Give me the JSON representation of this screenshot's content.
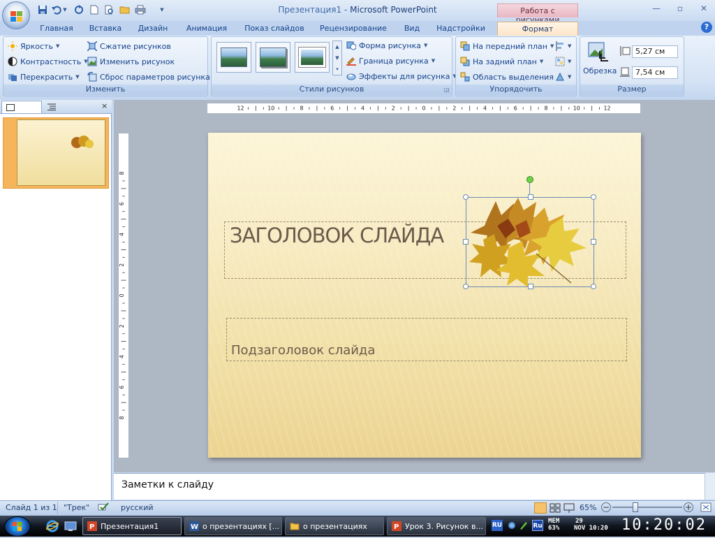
{
  "window": {
    "doc_title": "Презентация1",
    "separator": " - ",
    "app_title": "Microsoft PowerPoint",
    "context_header": "Работа с рисунками"
  },
  "tabs": [
    "Главная",
    "Вставка",
    "Дизайн",
    "Анимация",
    "Показ слайдов",
    "Рецензирование",
    "Вид",
    "Надстройки",
    "Формат"
  ],
  "ribbon": {
    "adjust": {
      "label": "Изменить",
      "brightness": "Яркость",
      "contrast": "Контрастность",
      "recolor": "Перекрасить",
      "compress": "Сжатие рисунков",
      "change": "Изменить рисунок",
      "reset": "Сброс параметров рисунка"
    },
    "styles": {
      "label": "Стили рисунков",
      "shape": "Форма рисунка",
      "border": "Граница рисунка",
      "effects": "Эффекты для рисунка"
    },
    "arrange": {
      "label": "Упорядочить",
      "front": "На передний план",
      "back": "На задний план",
      "selection": "Область выделения"
    },
    "size": {
      "label": "Размер",
      "crop": "Обрезка",
      "height": "5,27 см",
      "width": "7,54 см"
    }
  },
  "panel": {
    "slide_number": "1"
  },
  "ruler": {
    "h_labels": [
      "12",
      "10",
      "8",
      "6",
      "4",
      "2",
      "0",
      "2",
      "4",
      "6",
      "8",
      "10",
      "12"
    ],
    "v_labels": [
      "8",
      "6",
      "4",
      "2",
      "0",
      "2",
      "4",
      "6",
      "8"
    ]
  },
  "slide": {
    "title": "ЗАГОЛОВОК СЛАЙДА",
    "subtitle": "Подзаголовок слайда"
  },
  "notes": {
    "placeholder": "Заметки к слайду"
  },
  "status": {
    "slide_info": "Слайд 1 из 1",
    "theme": "\"Трек\"",
    "language": "русский",
    "zoom": "65%",
    "zoom_level": 0.65
  },
  "taskbar": {
    "tasks": [
      "Презентация1",
      "о презентациях [...",
      "о презентациях",
      "Урок 3. Рисунок в..."
    ],
    "lang": "RU",
    "kbd": "Ru",
    "mem_label": "MEM",
    "mem_value": "63%",
    "date_day": "29",
    "date_rest": "NOV 10:20",
    "clock": "10:20:02"
  },
  "colors": {
    "accent": "#15428b",
    "context_tab": "#e8b7c3",
    "slide_bg": "#f1dfa5",
    "selected_thumb": "#f6b55a"
  }
}
